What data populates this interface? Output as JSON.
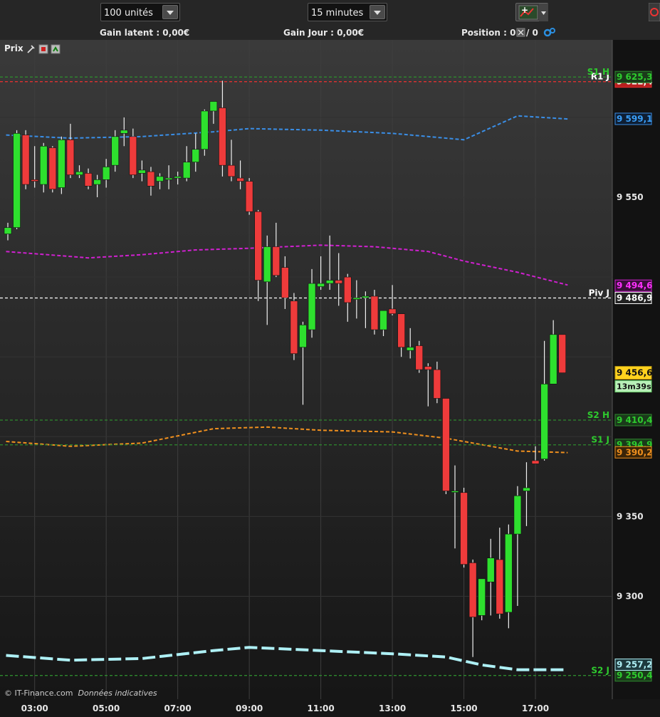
{
  "toolbar": {
    "quantity": "100 unités",
    "interval": "15 minutes"
  },
  "info": {
    "gain_latent": "Gain latent : 0,00€",
    "gain_jour": "Gain Jour : 0,00€",
    "position": "Position : 0",
    "position_suffix": " / 0"
  },
  "legend": {
    "label": "Prix"
  },
  "footer": {
    "copyright": "© IT-Finance.com",
    "disclaimer": "Données indicatives"
  },
  "colors": {
    "bull": "#2ee02e",
    "bear": "#ee3b3b",
    "resistance": "#e03030",
    "support": "#2e8b2e",
    "pivot": "#ffffff",
    "blue_ma": "#3a8ee6",
    "magenta_ma": "#d020d0",
    "orange_ma": "#f0901e",
    "cyan_ma": "#aef0f5",
    "current": "#ffd21e"
  },
  "chart_data": {
    "type": "candlestick",
    "x_labels": [
      "03:00",
      "05:00",
      "07:00",
      "09:00",
      "11:00",
      "13:00",
      "15:00",
      "17:00"
    ],
    "y_ticks": [
      9300,
      9350,
      9550
    ],
    "ylim": [
      9245,
      9640
    ],
    "current_price": "9 456,6",
    "countdown": "13m39s",
    "levels": [
      {
        "name": "R1 J",
        "label": "9 622,4",
        "value": 9622.4,
        "color": "#e03030",
        "text_color": "#ffffff",
        "box": "#b81e1e"
      },
      {
        "name": "S1 H",
        "label": "9 625,3",
        "value": 9625.3,
        "color": "#2e8b2e",
        "text_color": "#2ecc2e",
        "box": "#1a3a1a"
      },
      {
        "name": "",
        "label": "9 599,1",
        "value": 9599.1,
        "color": "#3a8ee6",
        "text_color": "#3a9ef6",
        "box": "#0e1e33"
      },
      {
        "name": "",
        "label": "9 494,6",
        "value": 9494.6,
        "color": "#d020d0",
        "text_color": "#ff30ff",
        "box": "#3a0e3a"
      },
      {
        "name": "Piv J",
        "label": "9 486,9",
        "value": 9486.9,
        "color": "#ffffff",
        "text_color": "#ffffff",
        "box": "#222222"
      },
      {
        "name": "S2 H",
        "label": "9 410,4",
        "value": 9410.4,
        "color": "#2e8b2e",
        "text_color": "#2ecc2e",
        "box": "#1a3a1a"
      },
      {
        "name": "S1 J",
        "label": "9 394,9",
        "value": 9394.9,
        "color": "#2e8b2e",
        "text_color": "#2ecc2e",
        "box": "#1a3a1a"
      },
      {
        "name": "",
        "label": "9 390,2",
        "value": 9390.2,
        "color": "#f0901e",
        "text_color": "#f0901e",
        "box": "#3a2408"
      },
      {
        "name": "S2 J",
        "label": "9 250,4",
        "value": 9250.4,
        "color": "#2e8b2e",
        "text_color": "#2ecc2e",
        "box": "#1a3a1a"
      },
      {
        "name": "",
        "label": "9 257,2",
        "value": 9257.2,
        "color": "#aef0f5",
        "text_color": "#aef0f5",
        "box": "#1e3a3e"
      }
    ],
    "candles": [
      {
        "t": "02:15",
        "o": 9527,
        "h": 9534,
        "l": 9523,
        "c": 9531
      },
      {
        "t": "02:30",
        "o": 9531,
        "h": 9592,
        "l": 9530,
        "c": 9590
      },
      {
        "t": "02:45",
        "o": 9589,
        "h": 9592,
        "l": 9555,
        "c": 9558
      },
      {
        "t": "03:00",
        "o": 9561,
        "h": 9582,
        "l": 9556,
        "c": 9560
      },
      {
        "t": "03:15",
        "o": 9558,
        "h": 9584,
        "l": 9553,
        "c": 9582
      },
      {
        "t": "03:30",
        "o": 9581,
        "h": 9582,
        "l": 9553,
        "c": 9555
      },
      {
        "t": "03:45",
        "o": 9556,
        "h": 9588,
        "l": 9552,
        "c": 9586
      },
      {
        "t": "04:00",
        "o": 9586,
        "h": 9596,
        "l": 9562,
        "c": 9564
      },
      {
        "t": "04:15",
        "o": 9564,
        "h": 9570,
        "l": 9562,
        "c": 9566
      },
      {
        "t": "04:30",
        "o": 9565,
        "h": 9568,
        "l": 9555,
        "c": 9557
      },
      {
        "t": "04:45",
        "o": 9558,
        "h": 9564,
        "l": 9550,
        "c": 9561
      },
      {
        "t": "05:00",
        "o": 9561,
        "h": 9574,
        "l": 9556,
        "c": 9569
      },
      {
        "t": "05:15",
        "o": 9570,
        "h": 9592,
        "l": 9566,
        "c": 9588
      },
      {
        "t": "05:30",
        "o": 9590,
        "h": 9600,
        "l": 9582,
        "c": 9592
      },
      {
        "t": "05:45",
        "o": 9588,
        "h": 9593,
        "l": 9562,
        "c": 9564
      },
      {
        "t": "06:00",
        "o": 9565,
        "h": 9573,
        "l": 9560,
        "c": 9567
      },
      {
        "t": "06:15",
        "o": 9566,
        "h": 9569,
        "l": 9551,
        "c": 9557
      },
      {
        "t": "06:30",
        "o": 9560,
        "h": 9565,
        "l": 9555,
        "c": 9563
      },
      {
        "t": "06:45",
        "o": 9561,
        "h": 9570,
        "l": 9555,
        "c": 9562
      },
      {
        "t": "07:00",
        "o": 9562,
        "h": 9566,
        "l": 9558,
        "c": 9563
      },
      {
        "t": "07:15",
        "o": 9562,
        "h": 9582,
        "l": 9560,
        "c": 9572
      },
      {
        "t": "07:30",
        "o": 9572,
        "h": 9590,
        "l": 9566,
        "c": 9580
      },
      {
        "t": "07:45",
        "o": 9580,
        "h": 9605,
        "l": 9576,
        "c": 9604
      },
      {
        "t": "08:00",
        "o": 9604,
        "h": 9610,
        "l": 9596,
        "c": 9610
      },
      {
        "t": "08:15",
        "o": 9606,
        "h": 9623,
        "l": 9563,
        "c": 9570
      },
      {
        "t": "08:30",
        "o": 9570,
        "h": 9586,
        "l": 9560,
        "c": 9563
      },
      {
        "t": "08:45",
        "o": 9562,
        "h": 9573,
        "l": 9555,
        "c": 9560
      },
      {
        "t": "09:00",
        "o": 9560,
        "h": 9562,
        "l": 9539,
        "c": 9541
      },
      {
        "t": "09:15",
        "o": 9541,
        "h": 9542,
        "l": 9485,
        "c": 9498
      },
      {
        "t": "09:30",
        "o": 9497,
        "h": 9526,
        "l": 9470,
        "c": 9519
      },
      {
        "t": "09:45",
        "o": 9519,
        "h": 9534,
        "l": 9500,
        "c": 9501
      },
      {
        "t": "10:00",
        "o": 9506,
        "h": 9513,
        "l": 9480,
        "c": 9487
      },
      {
        "t": "10:15",
        "o": 9485,
        "h": 9490,
        "l": 9448,
        "c": 9452
      },
      {
        "t": "10:30",
        "o": 9456,
        "h": 9472,
        "l": 9420,
        "c": 9470
      },
      {
        "t": "10:45",
        "o": 9467,
        "h": 9505,
        "l": 9462,
        "c": 9496
      },
      {
        "t": "11:00",
        "o": 9494,
        "h": 9513,
        "l": 9492,
        "c": 9496
      },
      {
        "t": "11:15",
        "o": 9496,
        "h": 9526,
        "l": 9492,
        "c": 9498
      },
      {
        "t": "11:30",
        "o": 9498,
        "h": 9515,
        "l": 9482,
        "c": 9496
      },
      {
        "t": "11:45",
        "o": 9500,
        "h": 9502,
        "l": 9472,
        "c": 9484
      },
      {
        "t": "12:00",
        "o": 9486,
        "h": 9498,
        "l": 9474,
        "c": 9487
      },
      {
        "t": "12:15",
        "o": 9487,
        "h": 9491,
        "l": 9468,
        "c": 9488
      },
      {
        "t": "12:30",
        "o": 9488,
        "h": 9492,
        "l": 9464,
        "c": 9467
      },
      {
        "t": "12:45",
        "o": 9467,
        "h": 9477,
        "l": 9463,
        "c": 9479
      },
      {
        "t": "13:00",
        "o": 9480,
        "h": 9495,
        "l": 9476,
        "c": 9477
      },
      {
        "t": "13:15",
        "o": 9477,
        "h": 9477,
        "l": 9450,
        "c": 9456
      },
      {
        "t": "13:30",
        "o": 9454,
        "h": 9468,
        "l": 9449,
        "c": 9456
      },
      {
        "t": "13:45",
        "o": 9457,
        "h": 9460,
        "l": 9440,
        "c": 9442
      },
      {
        "t": "14:00",
        "o": 9444,
        "h": 9446,
        "l": 9419,
        "c": 9442
      },
      {
        "t": "14:15",
        "o": 9442,
        "h": 9447,
        "l": 9421,
        "c": 9424
      },
      {
        "t": "14:30",
        "o": 9424,
        "h": 9424,
        "l": 9364,
        "c": 9366
      },
      {
        "t": "14:45",
        "o": 9366,
        "h": 9382,
        "l": 9330,
        "c": 9366
      },
      {
        "t": "15:00",
        "o": 9365,
        "h": 9368,
        "l": 9318,
        "c": 9320
      },
      {
        "t": "15:15",
        "o": 9321,
        "h": 9323,
        "l": 9262,
        "c": 9287
      },
      {
        "t": "15:30",
        "o": 9288,
        "h": 9311,
        "l": 9285,
        "c": 9311
      },
      {
        "t": "15:45",
        "o": 9309,
        "h": 9336,
        "l": 9288,
        "c": 9324
      },
      {
        "t": "16:00",
        "o": 9323,
        "h": 9343,
        "l": 9286,
        "c": 9289
      },
      {
        "t": "16:15",
        "o": 9290,
        "h": 9345,
        "l": 9280,
        "c": 9339
      },
      {
        "t": "16:30",
        "o": 9339,
        "h": 9369,
        "l": 9294,
        "c": 9363
      },
      {
        "t": "16:45",
        "o": 9366,
        "h": 9384,
        "l": 9344,
        "c": 9368
      },
      {
        "t": "17:00",
        "o": 9385,
        "h": 9394,
        "l": 9385,
        "c": 9383
      },
      {
        "t": "17:15",
        "o": 9386,
        "h": 9460,
        "l": 9385,
        "c": 9433
      },
      {
        "t": "17:30",
        "o": 9433,
        "h": 9473,
        "l": 9433,
        "c": 9464
      },
      {
        "t": "17:45",
        "o": 9464,
        "h": 9464,
        "l": 9440,
        "c": 9440
      }
    ]
  }
}
